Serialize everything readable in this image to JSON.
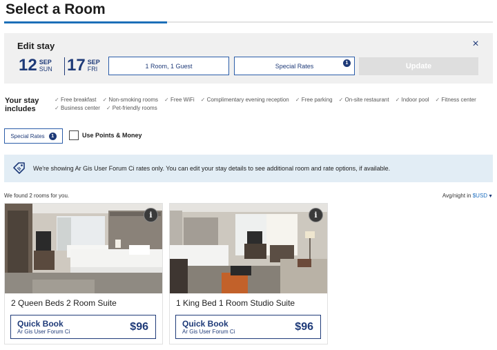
{
  "page": {
    "title": "Select a Room"
  },
  "edit_stay": {
    "title": "Edit stay",
    "close_icon": "×",
    "check_in": {
      "day": "12",
      "month": "SEP",
      "weekday": "SUN"
    },
    "check_out": {
      "day": "17",
      "month": "SEP",
      "weekday": "FRI"
    },
    "rooms_guests": "1 Room, 1 Guest",
    "special_rates": {
      "label": "Special Rates",
      "count": "1"
    },
    "update_label": "Update"
  },
  "stay_includes": {
    "label": "Your stay includes",
    "amenities": [
      "Free breakfast",
      "Non-smoking rooms",
      "Free WiFi",
      "Complimentary evening reception",
      "Free parking",
      "On-site restaurant",
      "Indoor pool",
      "Fitness center",
      "Business center",
      "Pet-friendly rooms"
    ]
  },
  "filters": {
    "special_rates": {
      "label": "Special Rates",
      "count": "1"
    },
    "points_money_label": "Use Points & Money"
  },
  "banner": {
    "icon": "tag-icon",
    "text": "We're showing Ar Gis User Forum Ci rates only. You can edit your stay details to see additional room and rate options, if available."
  },
  "results": {
    "found_text": "We found 2 rooms for you.",
    "avg_prefix": "Avg/night in ",
    "currency": "$USD",
    "caret": "▼"
  },
  "rooms": [
    {
      "name": "2 Queen Beds 2 Room Suite",
      "info": "i",
      "quick_book": {
        "title": "Quick Book",
        "rate": "Ar Gis User Forum Ci",
        "price": "$96"
      }
    },
    {
      "name": "1 King Bed 1 Room Studio Suite",
      "info": "i",
      "quick_book": {
        "title": "Quick Book",
        "rate": "Ar Gis User Forum Ci",
        "price": "$96"
      }
    }
  ],
  "colors": {
    "accent": "#1e3a78",
    "link": "#1c6fb8",
    "panel": "#f0f0f0",
    "banner": "#e2edf5",
    "disabled": "#dedede"
  }
}
